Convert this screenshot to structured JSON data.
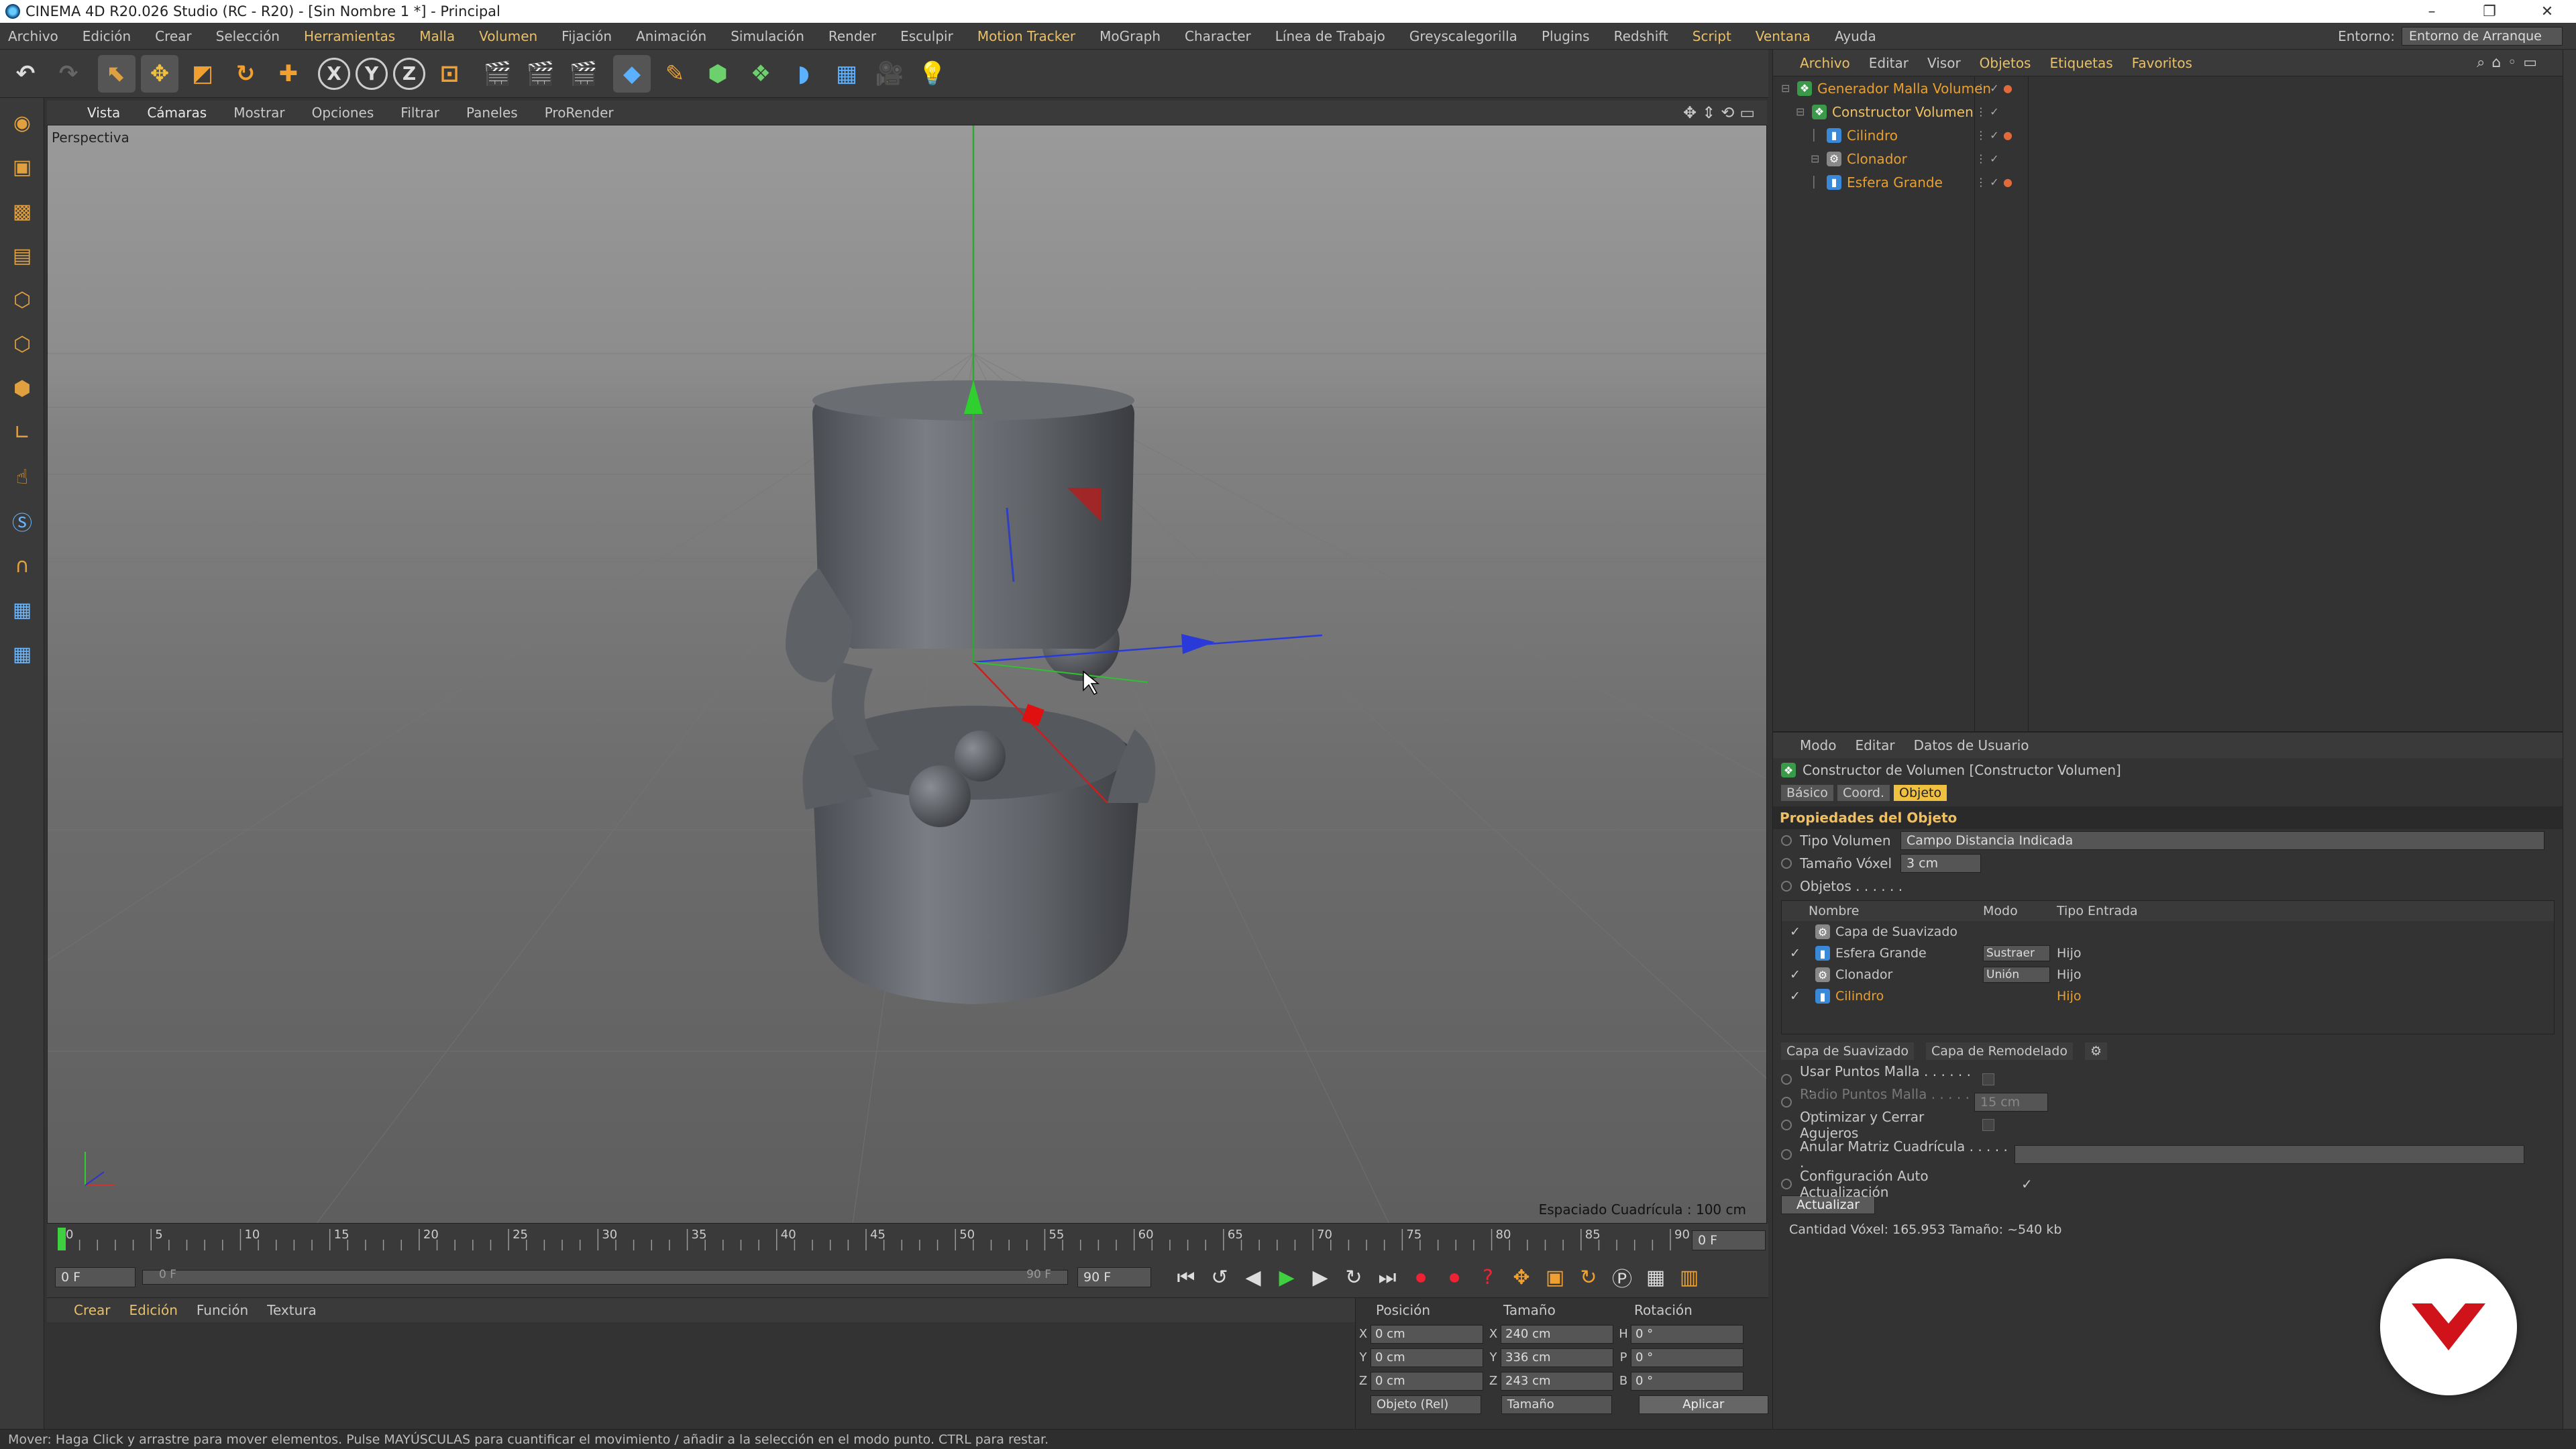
{
  "window": {
    "title": "CINEMA 4D R20.026 Studio (RC - R20) - [Sin Nombre 1 *] - Principal",
    "controls": [
      "–",
      "❐",
      "✕"
    ]
  },
  "menubar": {
    "items": [
      "Archivo",
      "Edición",
      "Crear",
      "Selección",
      "Herramientas",
      "Malla",
      "Volumen",
      "Fijación",
      "Animación",
      "Simulación",
      "Render",
      "Esculpir",
      "Motion Tracker",
      "MoGraph",
      "Character",
      "Línea de Trabajo",
      "Greyscalegorilla",
      "Plugins",
      "Redshift",
      "Script",
      "Ventana",
      "Ayuda"
    ],
    "highlighted": [
      "Herramientas",
      "Malla",
      "Volumen",
      "Motion Tracker",
      "Script",
      "Ventana"
    ],
    "environment_label": "Entorno:",
    "environment_value": "Entorno de Arranque"
  },
  "toolbar": {
    "axis_x": "X",
    "axis_y": "Y",
    "axis_z": "Z"
  },
  "viewport": {
    "menu": [
      "Vista",
      "Cámaras",
      "Mostrar",
      "Opciones",
      "Filtrar",
      "Paneles",
      "ProRender"
    ],
    "camera_label": "Perspectiva",
    "grid_spacing": "Espaciado Cuadrícula : 100 cm"
  },
  "timeline": {
    "ticks": [
      "0",
      "5",
      "10",
      "15",
      "20",
      "25",
      "30",
      "35",
      "40",
      "45",
      "50",
      "55",
      "60",
      "65",
      "70",
      "75",
      "80",
      "85",
      "90"
    ],
    "end_field": "0 F",
    "current_frame": "0 F",
    "range_start": "0 F",
    "range_end": "90 F",
    "max_frame": "90 F"
  },
  "materials": {
    "menu": [
      "Crear",
      "Edición",
      "Función",
      "Textura"
    ]
  },
  "coords": {
    "headers": [
      "Posición",
      "Tamaño",
      "Rotación"
    ],
    "rows": [
      {
        "axis": "X",
        "pos": "0 cm",
        "size_axis": "X",
        "size": "240 cm",
        "rot_axis": "H",
        "rot": "0 °"
      },
      {
        "axis": "Y",
        "pos": "0 cm",
        "size_axis": "Y",
        "size": "336 cm",
        "rot_axis": "P",
        "rot": "0 °"
      },
      {
        "axis": "Z",
        "pos": "0 cm",
        "size_axis": "Z",
        "size": "243 cm",
        "rot_axis": "B",
        "rot": "0 °"
      }
    ],
    "mode": "Objeto (Rel)",
    "size_mode": "Tamaño",
    "apply": "Aplicar"
  },
  "status": "Mover: Haga Click y arrastre para mover elementos. Pulse MAYÚSCULAS para cuantificar el movimiento / añadir a la selección en el modo punto. CTRL para restar.",
  "object_manager": {
    "menu": [
      "Archivo",
      "Editar",
      "Visor",
      "Objetos",
      "Etiquetas",
      "Favoritos"
    ],
    "objects": [
      {
        "name": "Generador Malla Volumen",
        "indent": 0,
        "icon": "green"
      },
      {
        "name": "Constructor Volumen",
        "indent": 1,
        "icon": "green"
      },
      {
        "name": "Cilindro",
        "indent": 2,
        "icon": "blue"
      },
      {
        "name": "Clonador",
        "indent": 2,
        "icon": "gray"
      },
      {
        "name": "Esfera Grande",
        "indent": 2,
        "icon": "blue"
      }
    ]
  },
  "attributes": {
    "menu": [
      "Modo",
      "Editar",
      "Datos de Usuario"
    ],
    "title": "Constructor de Volumen [Constructor Volumen]",
    "tabs": [
      "Básico",
      "Coord.",
      "Objeto"
    ],
    "section": "Propiedades del Objeto",
    "volume_type_label": "Tipo Volumen",
    "volume_type": "Campo Distancia Indicada",
    "voxel_label": "Tamaño Vóxel",
    "voxel_size": "3 cm",
    "objects_label": "Objetos . . . . . .",
    "table_headers": [
      "Nombre",
      "Modo",
      "Tipo Entrada"
    ],
    "table_rows": [
      {
        "name": "Capa de Suavizado",
        "mode": "",
        "input": ""
      },
      {
        "name": "Esfera Grande",
        "mode": "Sustraer",
        "input": "Hijo"
      },
      {
        "name": "Clonador",
        "mode": "Unión",
        "input": "Hijo"
      },
      {
        "name": "Cilindro",
        "mode": "",
        "input": "Hijo"
      }
    ],
    "layer_buttons": [
      "Capa de Suavizado",
      "Capa de Remodelado"
    ],
    "use_mesh_points": "Usar Puntos Malla . . . . . . . .",
    "mesh_radius": "Radio Puntos Malla . . . . . . . .",
    "mesh_radius_value": "15 cm",
    "optimize_close": "Optimizar y Cerrar Agujeros",
    "override_grid": "Anular Matriz Cuadrícula . . . . . .",
    "auto_update": "Configuración Auto Actualización",
    "auto_update_check": "✓",
    "update_button": "Actualizar",
    "info": "Cantidad Vóxel: 165.953  Tamaño: ~540 kb"
  },
  "colors": {
    "accent": "#f0c040",
    "selected_text": "#e8a030",
    "badge_red": "#d0121b"
  }
}
